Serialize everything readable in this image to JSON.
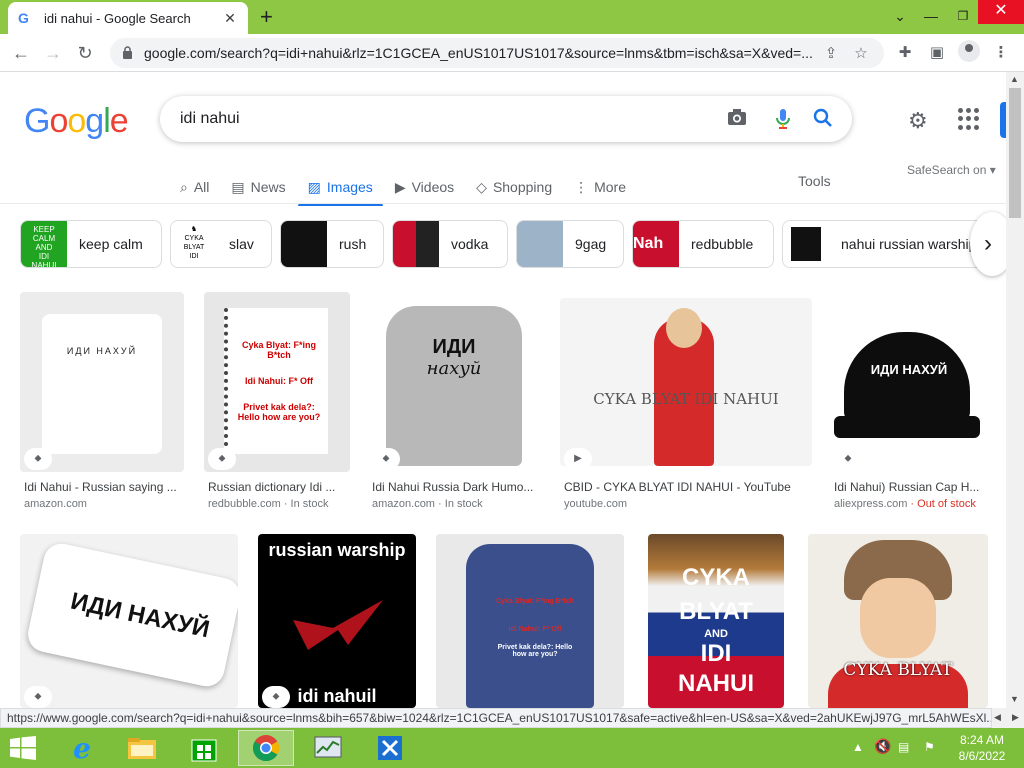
{
  "browser": {
    "tab_title": "idi nahui - Google Search",
    "url": "google.com/search?q=idi+nahui&rlz=1C1GCEA_enUS1017US1017&source=lnms&tbm=isch&sa=X&ved=...",
    "status_url": "https://www.google.com/search?q=idi+nahui&source=lnms&bih=657&biw=1024&rlz=1C1GCEA_enUS1017US1017&safe=active&hl=en-US&sa=X&ved=2ahUKEwjJ97G_mrL5AhWEsXl..."
  },
  "google": {
    "logo": "Google",
    "query": "idi nahui",
    "tabs": [
      {
        "label": "All",
        "icon": "search-icon"
      },
      {
        "label": "News",
        "icon": "news-icon"
      },
      {
        "label": "Images",
        "icon": "image-icon"
      },
      {
        "label": "Videos",
        "icon": "video-icon"
      },
      {
        "label": "Shopping",
        "icon": "tag-icon"
      },
      {
        "label": "More",
        "icon": "more-vert-icon"
      }
    ],
    "tools": "Tools",
    "safesearch": "SafeSearch on ▾",
    "chips": [
      "keep calm",
      "slav",
      "rush",
      "vodka",
      "9gag",
      "redbubble",
      "nahui russian warship"
    ],
    "results_row1": [
      {
        "caption": "Idi Nahui - Russian saying ...",
        "source": "amazon.com",
        "stock": "",
        "img_text": "ИДИ НАХУЙ"
      },
      {
        "caption": "Russian dictionary Idi ...",
        "source": "redbubble.com",
        "stock": " · In stock",
        "img_text1": "Cyka Blyat: F*ing B*tch",
        "img_text2": "Idi Nahui: F* Off",
        "img_text3": "Privet kak dela?: Hello how are you?"
      },
      {
        "caption": "Idi Nahui Russia Dark Humo...",
        "source": "amazon.com",
        "stock": " · In stock",
        "img_text1": "ИДИ",
        "img_text2": "нахуй"
      },
      {
        "caption": "CBID - CYKA BLYAT IDI NAHUI - YouTube",
        "source": "youtube.com",
        "stock": "",
        "img_text": "CYKA BLYAT IDI NAHUI"
      },
      {
        "caption": "Idi Nahui) Russian Cap H...",
        "source": "aliexpress.com",
        "stock": " · Out of stock",
        "img_text": "ИДИ НАХУЙ"
      }
    ],
    "results_row2": [
      {
        "img_text": "ИДИ НАХУЙ"
      },
      {
        "img_text1": "russian warship",
        "img_text2": "idi nahuil"
      },
      {
        "img_text1": "Cyka Blyat: F*ing B*tch",
        "img_text2": "Idi Nahui: F* Off",
        "img_text3": "Privet kak dela?: Hello how are you?"
      },
      {
        "img_text1": "CYKA",
        "img_text2": "BLYAT",
        "img_text3": "AND",
        "img_text4": "IDI",
        "img_text5": "NAHUI"
      },
      {
        "img_text": "CYKA BLYAT"
      }
    ]
  },
  "taskbar": {
    "time": "8:24 AM",
    "date": "8/6/2022"
  }
}
